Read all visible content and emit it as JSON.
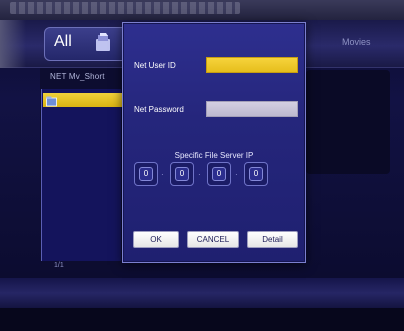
{
  "tabs": {
    "all_label": "All",
    "movies_label": "Movies"
  },
  "browser": {
    "path_label": "NET  Mv_Short",
    "page_counter": "1/1"
  },
  "dialog": {
    "user_id_label": "Net User ID",
    "user_id_value": "",
    "password_label": "Net Password",
    "password_value": "",
    "ip_title": "Specific File Server IP",
    "ip_octets": [
      "0",
      "0",
      "0",
      "0"
    ],
    "ip_separator": "·",
    "buttons": {
      "ok": "OK",
      "cancel": "CANCEL",
      "detail": "Detail"
    }
  },
  "colors": {
    "focus_yellow": "#f1d13a",
    "dialog_blue": "#2a2b86",
    "field_gray": "#c8c4d8"
  },
  "icons": {
    "tab_all_icon": "media-folder-icon",
    "file_row_icon": "network-folder-icon"
  }
}
